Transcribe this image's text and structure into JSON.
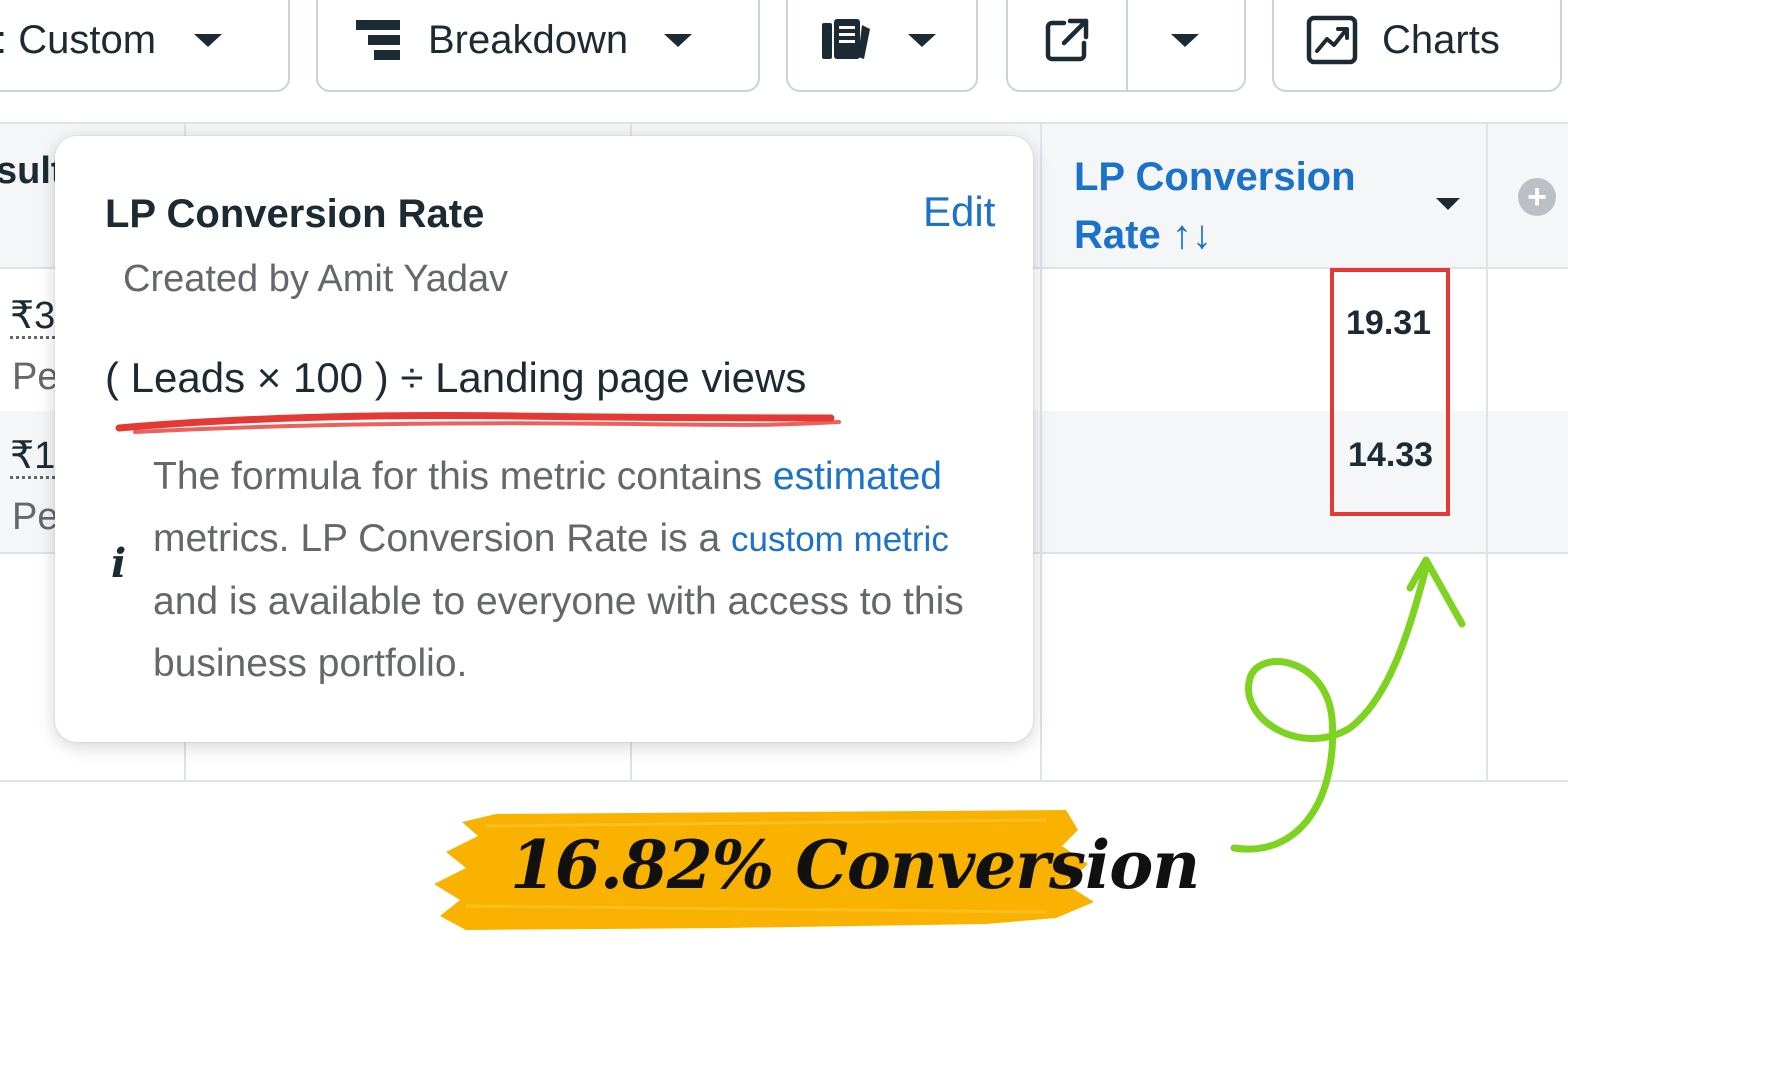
{
  "toolbar": {
    "columns_label": ": Custom",
    "breakdown_label": "Breakdown",
    "charts_label": "Charts",
    "icons": [
      "breakdown-icon",
      "reports-icon",
      "export-icon",
      "charts-icon"
    ]
  },
  "table": {
    "left_header_fragment": "sult",
    "column_header": {
      "title": "LP Conversion Rate ↑↓",
      "sort_icon": "sort-arrows-icon"
    },
    "rows": [
      {
        "left_value": "₹3",
        "left_sub": "Pe",
        "lp_conversion_rate": "19.31"
      },
      {
        "left_value": "₹1",
        "left_sub": "Pe",
        "lp_conversion_rate": "14.33"
      }
    ]
  },
  "tooltip": {
    "title": "LP Conversion Rate",
    "edit_label": "Edit",
    "creator": "Created by Amit Yadav",
    "formula": "( Leads × 100 ) ÷ Landing page views",
    "desc_part1": "The formula for this metric contains ",
    "desc_link1": "estimated",
    "desc_part2": " metrics. LP Conversion Rate is a ",
    "desc_link2": "custom metric",
    "desc_part3": " and is available to everyone with access to this business portfolio."
  },
  "annotation": {
    "summary": "16.82% Conversion",
    "colors": {
      "highlight": "#e53935",
      "arrow": "#7ed321",
      "badge": "#f9b200",
      "underline": "#e53935"
    }
  }
}
